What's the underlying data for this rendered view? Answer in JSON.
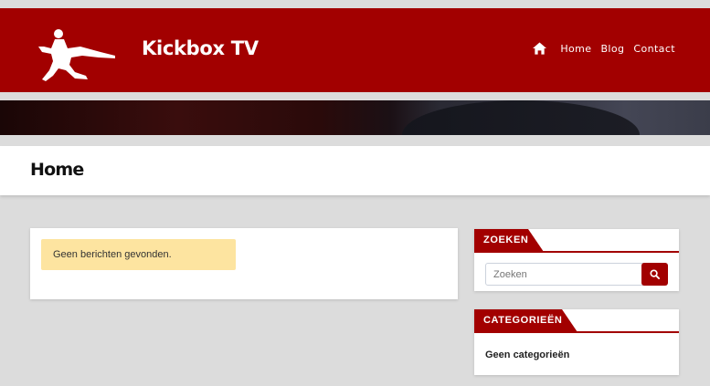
{
  "site": {
    "title": "Kickbox TV"
  },
  "nav": {
    "items": [
      "Home",
      "Blog",
      "Contact"
    ]
  },
  "page": {
    "title": "Home"
  },
  "main": {
    "notice": "Geen berichten gevonden."
  },
  "sidebar": {
    "search": {
      "heading": "ZOEKEN",
      "placeholder": "Zoeken"
    },
    "categories": {
      "heading": "CATEGORIEËN",
      "empty": "Geen categorieën"
    }
  },
  "colors": {
    "brand": "#a20000",
    "notice_bg": "#fde4a0",
    "background": "#dcdcdc"
  },
  "icons": {
    "logo": "kickboxer-silhouette-icon",
    "home": "home-icon",
    "search": "search-icon"
  }
}
